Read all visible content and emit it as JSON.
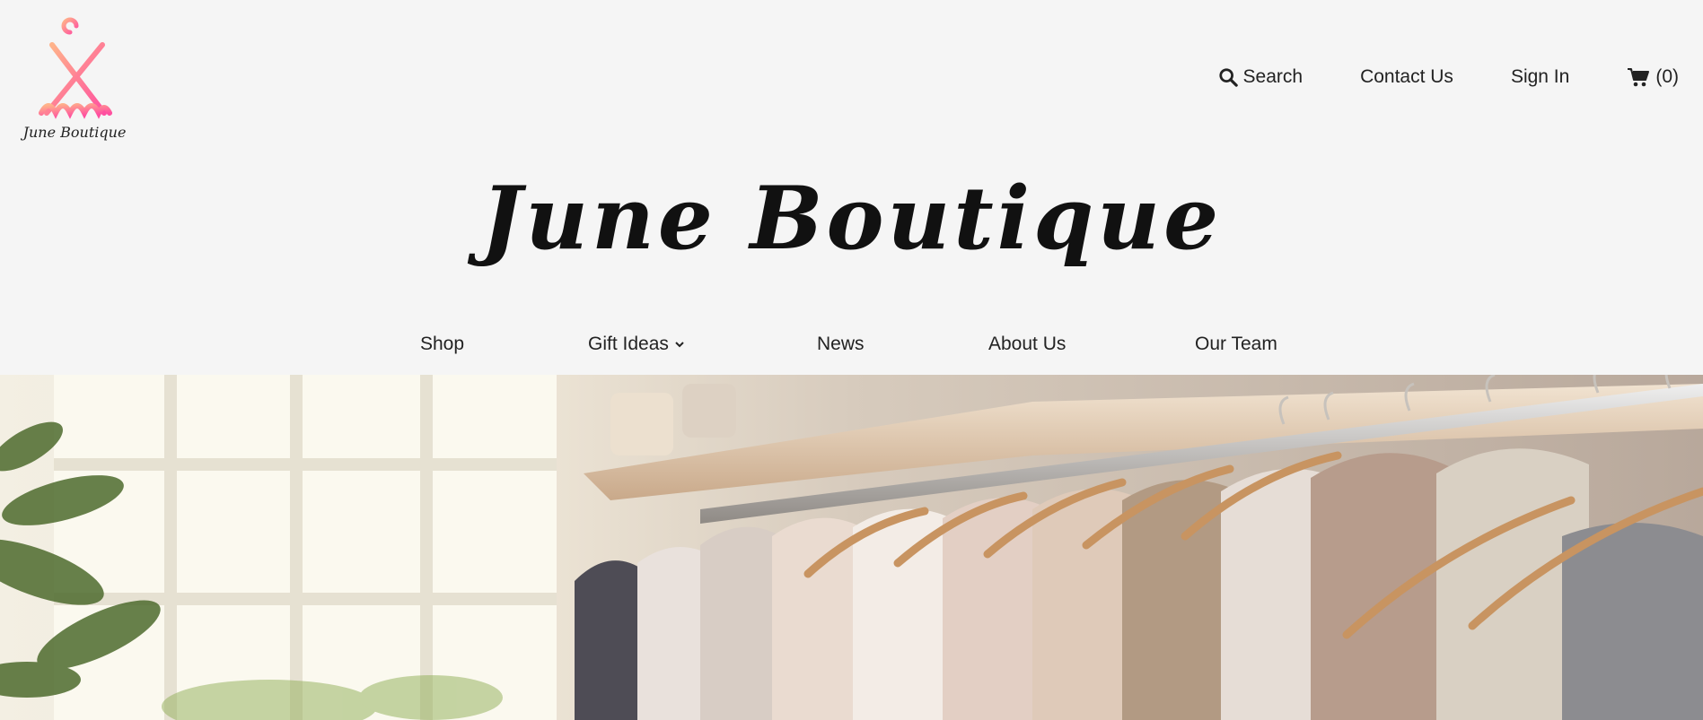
{
  "logo": {
    "text": "June Boutique",
    "icon": "hanger-dress-icon",
    "gradient_from": "#f49ab5",
    "gradient_to": "#ff5fa2"
  },
  "util_nav": {
    "search_label": "Search",
    "contact_label": "Contact Us",
    "signin_label": "Sign In",
    "cart_count": "(0)"
  },
  "brand": {
    "title": "June Boutique"
  },
  "main_nav": {
    "items": [
      {
        "label": "Shop"
      },
      {
        "label": "Gift Ideas"
      },
      {
        "label": "News"
      },
      {
        "label": "About Us"
      },
      {
        "label": "Our Team"
      }
    ]
  },
  "hero": {
    "image": "clothing-rack-photo"
  }
}
